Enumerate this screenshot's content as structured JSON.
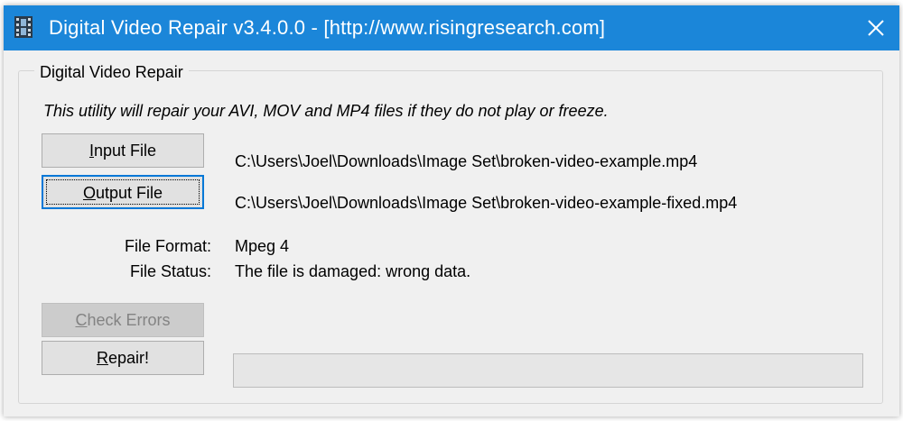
{
  "window": {
    "title": "Digital Video Repair v3.4.0.0 - [http://www.risingresearch.com]",
    "icon": "film-strip-icon",
    "close_icon": "close-icon",
    "titlebar_color": "#1b86d9"
  },
  "group": {
    "title": "Digital Video Repair",
    "intro": "This utility will repair your AVI, MOV and MP4 files if they do not play or freeze."
  },
  "buttons": {
    "input_file": {
      "prefix": "",
      "accel": "I",
      "rest": "nput File"
    },
    "output_file": {
      "prefix": "",
      "accel": "O",
      "rest": "utput File"
    },
    "check_errors": {
      "prefix": "",
      "accel": "C",
      "rest": "heck Errors",
      "enabled": false
    },
    "repair": {
      "prefix": "",
      "accel": "R",
      "rest": "epair!"
    }
  },
  "paths": {
    "input": "C:\\Users\\Joel\\Downloads\\Image Set\\broken-video-example.mp4",
    "output": "C:\\Users\\Joel\\Downloads\\Image Set\\broken-video-example-fixed.mp4"
  },
  "info": {
    "format_label": "File Format:",
    "format_value": "Mpeg 4",
    "status_label": "File Status:",
    "status_value": "The file is damaged: wrong data."
  },
  "progress": {
    "value": 0
  }
}
